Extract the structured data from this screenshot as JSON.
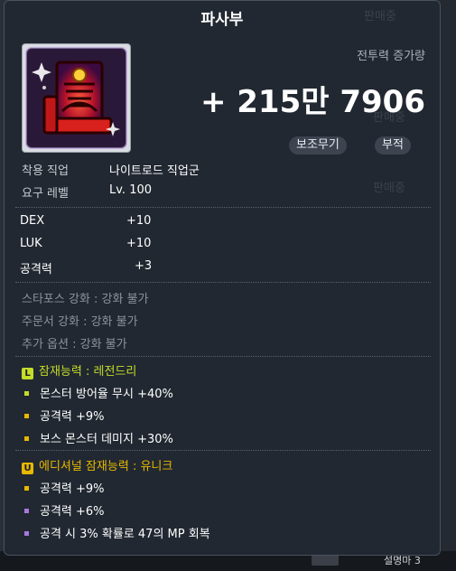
{
  "background": {
    "bottom_hint": "설명마 3"
  },
  "item": {
    "name": "파사부",
    "combat_power_label": "전투력 증가량",
    "combat_power_value": "+ 215만 7906",
    "tags": [
      "보조무기",
      "부적"
    ],
    "icon": "talisman-icon",
    "requirements": [
      {
        "label": "착용 직업",
        "value": "나이트로드 직업군"
      },
      {
        "label": "요구 레벨",
        "value": "Lv. 100"
      }
    ],
    "stats": [
      {
        "name": "DEX",
        "value": "+10"
      },
      {
        "name": "LUK",
        "value": "+10"
      },
      {
        "name": "공격력",
        "value": "+3"
      }
    ],
    "enhancements": [
      "스타포스 강화 : 강화 불가",
      "주문서 강화 : 강화 불가",
      "추가 옵션 : 강화 불가"
    ]
  },
  "background_ghosts": [
    "판매중",
    "판매중",
    "판매중"
  ],
  "potential": {
    "badge": "L",
    "title": "잠재능력 : 레전드리",
    "color": "#c5dc2a",
    "lines": [
      {
        "text": "몬스터 방어율 무시 +40%",
        "bullet_color": "#c5dc2a"
      },
      {
        "text": "공격력 +9%",
        "bullet_color": "#e8b800"
      },
      {
        "text": "보스 몬스터 데미지 +30%",
        "bullet_color": "#e8b800"
      }
    ]
  },
  "additional_potential": {
    "badge": "U",
    "title": "에디셔널 잠재능력 : 유니크",
    "color": "#e8b800",
    "lines": [
      {
        "text": "공격력 +9%",
        "bullet_color": "#e8b800"
      },
      {
        "text": "공격력 +6%",
        "bullet_color": "#a678e0"
      },
      {
        "text": "공격 시 3% 확률로 47의 MP 회복",
        "bullet_color": "#a678e0"
      }
    ]
  }
}
